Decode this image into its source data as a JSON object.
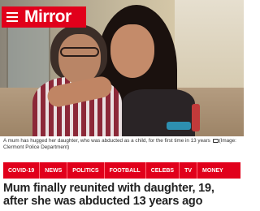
{
  "header": {
    "logo_text": "Mirror",
    "menu_icon": "hamburger-menu-icon",
    "brand_color": "#e1001b"
  },
  "article": {
    "image_caption_text": "A mum has hugged her daughter, who was abducted as a child, for the first time in 13 years",
    "image_credit": "(Image: Clermont Police Department)",
    "headline": "Mum finally reunited with daughter, 19, after she was abducted 13 years ago"
  },
  "nav": {
    "items": [
      {
        "label": "COVID-19"
      },
      {
        "label": "NEWS"
      },
      {
        "label": "POLITICS"
      },
      {
        "label": "FOOTBALL"
      },
      {
        "label": "CELEBS"
      },
      {
        "label": "TV"
      },
      {
        "label": "MONEY"
      }
    ]
  }
}
